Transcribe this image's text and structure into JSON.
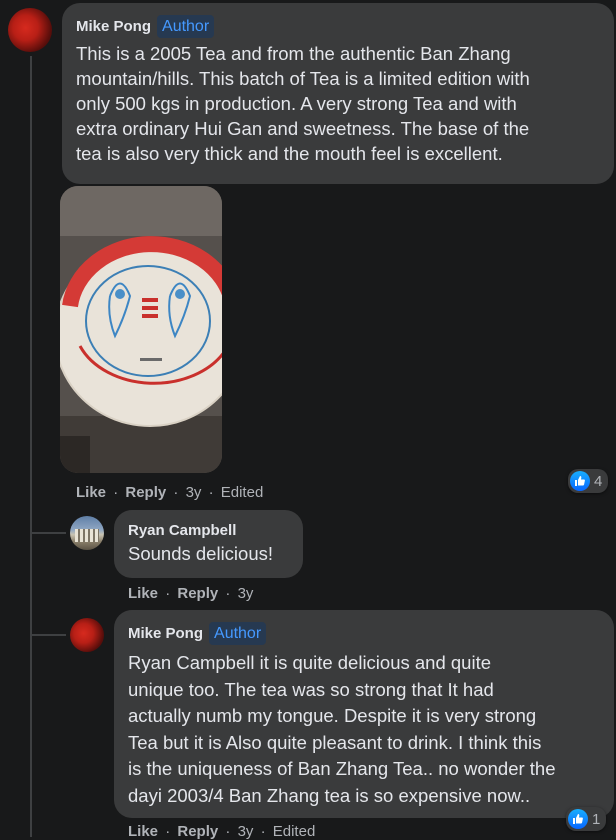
{
  "comments": [
    {
      "author": "Mike Pong",
      "badge": "Author",
      "text_lines": [
        "This is a 2005 Tea and from the authentic Ban Zhang",
        "mountain/hills. This batch of Tea is a limited edition with",
        "only 500 kgs in production. A very strong Tea and with",
        "extra ordinary Hui Gan and sweetness. The base of the",
        "tea is also very thick and the mouth feel is excellent."
      ],
      "actions": {
        "like": "Like",
        "reply": "Reply",
        "time": "3y",
        "edited": "Edited",
        "sep": "·"
      },
      "reactions": {
        "icon": "like-icon",
        "count": "4",
        "color": "#1877f2"
      }
    },
    {
      "author": "Ryan Campbell",
      "text": "Sounds delicious!",
      "actions": {
        "like": "Like",
        "reply": "Reply",
        "time": "3y",
        "sep": "·"
      }
    },
    {
      "author": "Mike Pong",
      "badge": "Author",
      "text_lines": [
        "Ryan Campbell it is quite delicious and quite",
        "unique too. The tea was so strong that It had",
        "actually numb my tongue. Despite it is very strong",
        "Tea but it is Also quite pleasant to drink. I think this",
        "is the uniqueness of Ban Zhang Tea.. no wonder the",
        "dayi 2003/4 Ban Zhang tea is so expensive now.."
      ],
      "actions": {
        "like": "Like",
        "reply": "Reply",
        "time": "3y",
        "edited": "Edited",
        "sep": "·"
      },
      "reactions": {
        "icon": "like-icon",
        "count": "1",
        "color": "#1877f2"
      }
    }
  ],
  "colors": {
    "background": "#18191a",
    "bubble": "#3a3b3c",
    "author_badge_bg": "#263951",
    "author_badge_text": "#4599ff",
    "secondary_text": "#b0b3b8"
  }
}
